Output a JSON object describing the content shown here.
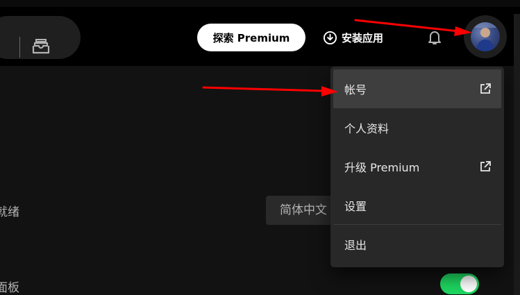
{
  "header": {
    "premium_button": "探索 Premium",
    "install_app": "安装应用"
  },
  "settings": {
    "partial_label_1": "就绪",
    "partial_label_2": "面板",
    "language_value": "简体中文",
    "toggle_on": true
  },
  "account_menu": {
    "items": [
      {
        "label": "帐号",
        "external": true
      },
      {
        "label": "个人资料",
        "external": false
      },
      {
        "label": "升级 Premium",
        "external": true
      },
      {
        "label": "设置",
        "external": false
      },
      {
        "label": "退出",
        "external": false
      }
    ]
  },
  "colors": {
    "accent_green": "#1ed760",
    "annotation_red": "#ff0000",
    "menu_bg": "#282828",
    "menu_hover": "#3e3e3e"
  },
  "icons": {
    "browse": "browse-icon",
    "download": "download-icon",
    "bell": "bell-icon",
    "external_link": "external-link-icon"
  }
}
